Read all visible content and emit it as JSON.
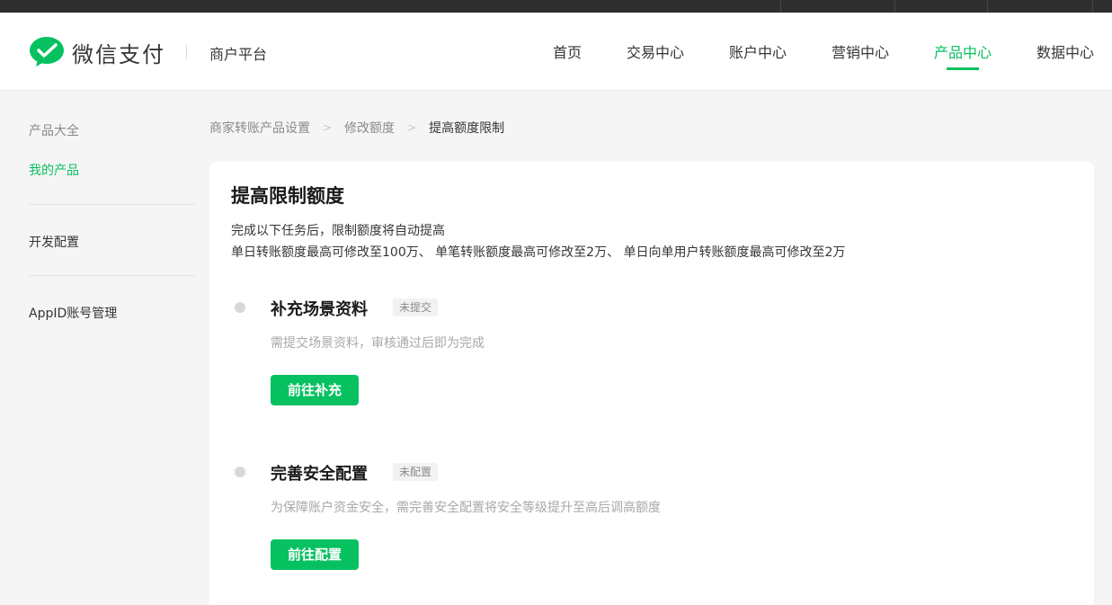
{
  "brand": {
    "logo_text": "微信支付",
    "platform": "商户平台",
    "accent": "#07c160"
  },
  "nav": {
    "items": [
      {
        "label": "首页"
      },
      {
        "label": "交易中心"
      },
      {
        "label": "账户中心"
      },
      {
        "label": "营销中心"
      },
      {
        "label": "产品中心",
        "active": true
      },
      {
        "label": "数据中心"
      }
    ]
  },
  "sidebar": {
    "group_title": "产品大全",
    "items": [
      {
        "label": "我的产品",
        "active": true
      },
      {
        "label": "开发配置"
      },
      {
        "label": "AppID账号管理"
      }
    ]
  },
  "breadcrumb": {
    "items": [
      "商家转账产品设置",
      "修改额度",
      "提高额度限制"
    ]
  },
  "card": {
    "title": "提高限制额度",
    "desc_line1": "完成以下任务后，限制额度将自动提高",
    "desc_line2": "单日转账额度最高可修改至100万、 单笔转账额度最高可修改至2万、 单日向单用户转账额度最高可修改至2万",
    "tasks": [
      {
        "title": "补充场景资料",
        "status": "未提交",
        "desc": "需提交场景资料，审核通过后即为完成",
        "button": "前往补充"
      },
      {
        "title": "完善安全配置",
        "status": "未配置",
        "desc": "为保障账户资金安全，需完善安全配置将安全等级提升至高后调高额度",
        "button": "前往配置"
      }
    ]
  }
}
